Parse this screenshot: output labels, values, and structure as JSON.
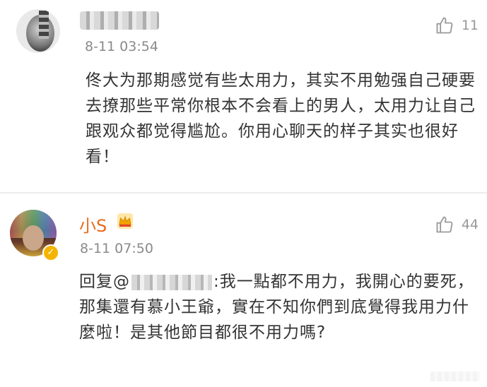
{
  "comments": [
    {
      "username": "",
      "time": "8-11 03:54",
      "likes": "11",
      "text": "佟大为那期感觉有些太用力，其实不用勉强自己硬要去撩那些平常你根本不会看上的男人，太用力让自己跟观众都觉得尴尬。你用心聊天的样子其实也很好看！"
    },
    {
      "username": "小S",
      "time": "8-11 07:50",
      "likes": "44",
      "reply_prefix": "回复@",
      "text": ":我一點都不用力，我開心的要死，那集還有慕小王爺，實在不知你們到底覺得我用力什麼啦！是其他節目都很不用力嗎?"
    }
  ],
  "icons": {
    "like": "thumbs-up-icon",
    "crown": "crown-badge-icon",
    "verified": "verified-badge-icon"
  },
  "colors": {
    "username": "#e86b1d",
    "meta": "#8a8a8a",
    "text": "#333333",
    "verified": "#f5b400"
  }
}
